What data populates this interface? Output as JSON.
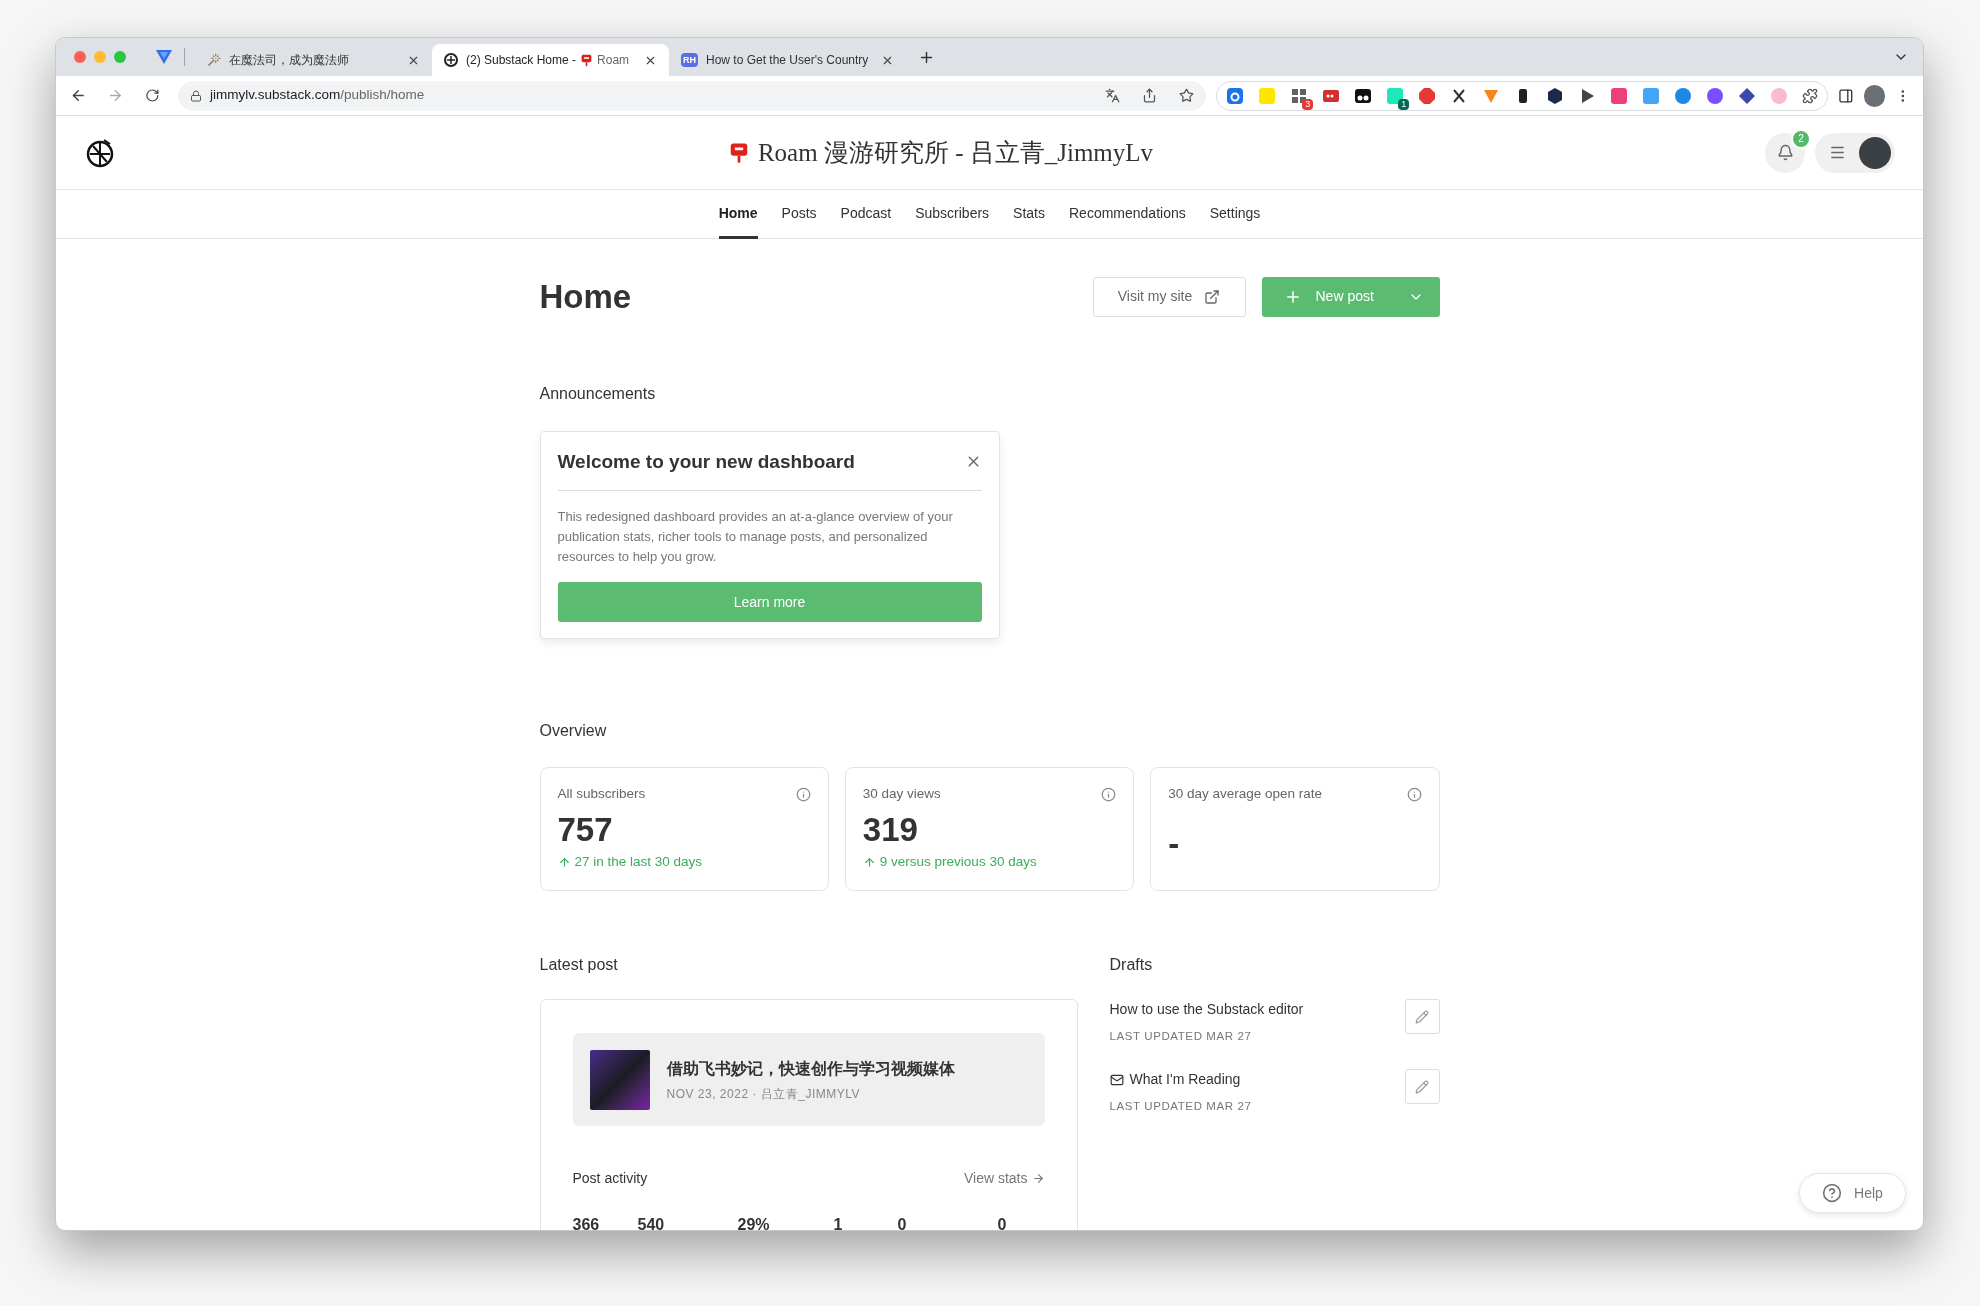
{
  "browser": {
    "tabs": [
      {
        "kind": "wand",
        "title": "在魔法司，成为魔法师",
        "selected": false
      },
      {
        "kind": "substack",
        "title": "(2) Substack Home -",
        "title_after": "Roam",
        "selected": true
      },
      {
        "kind": "rh",
        "badge": "RH",
        "title": "How to Get the User's Country",
        "selected": false
      }
    ],
    "url_host": "jimmylv.substack.com",
    "url_path": "/publish/home",
    "extensions": [
      {
        "kind": "d"
      },
      {
        "kind": "yellow"
      },
      {
        "kind": "grid",
        "badge": "3"
      },
      {
        "kind": "dots"
      },
      {
        "kind": "glasses"
      },
      {
        "kind": "teal",
        "badge": "1"
      },
      {
        "kind": "octagon"
      },
      {
        "kind": "scissors"
      },
      {
        "kind": "fox"
      },
      {
        "kind": "black"
      },
      {
        "kind": "hex"
      },
      {
        "kind": "play"
      },
      {
        "kind": "pink"
      },
      {
        "kind": "blue"
      },
      {
        "kind": "brain"
      },
      {
        "kind": "face"
      },
      {
        "kind": "diamond"
      },
      {
        "kind": "cloud"
      }
    ]
  },
  "header": {
    "site_title": "Roam 漫游研究所 - 吕立青_JimmyLv",
    "notification_count": "2"
  },
  "nav": [
    {
      "label": "Home",
      "selected": true
    },
    {
      "label": "Posts",
      "selected": false
    },
    {
      "label": "Podcast",
      "selected": false
    },
    {
      "label": "Subscribers",
      "selected": false
    },
    {
      "label": "Stats",
      "selected": false
    },
    {
      "label": "Recommendations",
      "selected": false
    },
    {
      "label": "Settings",
      "selected": false
    }
  ],
  "page": {
    "title": "Home",
    "visit_button": "Visit my site",
    "new_post_button": "New post"
  },
  "announcements": {
    "heading": "Announcements",
    "card_title": "Welcome to your new dashboard",
    "card_body": "This redesigned dashboard provides an at-a-glance overview of your publication stats, richer tools to manage posts, and personalized resources to help you grow.",
    "button": "Learn more"
  },
  "overview": {
    "heading": "Overview",
    "stats": [
      {
        "label": "All subscribers",
        "value": "757",
        "change": "27 in the last 30 days"
      },
      {
        "label": "30 day views",
        "value": "319",
        "change": "9 versus previous 30 days"
      },
      {
        "label": "30 day average open rate",
        "value": "-"
      }
    ]
  },
  "latest_post": {
    "heading": "Latest post",
    "title": "借助飞书妙记，快速创作与学习视频媒体",
    "meta": "NOV 23, 2022 · 吕立青_JIMMYLV",
    "activity_label": "Post activity",
    "view_stats": "View stats",
    "numbers": [
      "366",
      "540",
      "29%",
      "1",
      "0",
      "0"
    ]
  },
  "drafts": {
    "heading": "Drafts",
    "items": [
      {
        "kind": "post",
        "title": "How to use the Substack editor",
        "updated": "LAST UPDATED MAR 27"
      },
      {
        "kind": "email",
        "title": "What I'm Reading",
        "updated": "LAST UPDATED MAR 27"
      }
    ]
  },
  "help": "Help"
}
